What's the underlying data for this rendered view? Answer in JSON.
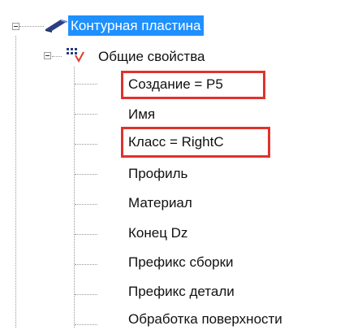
{
  "tree": {
    "root": {
      "label": "Контурная пластина",
      "icon": "plate-icon",
      "selected": true
    },
    "group": {
      "label": "Общие свойства",
      "icon": "properties-icon"
    },
    "properties": [
      {
        "label": "Создание = P5",
        "highlighted": true
      },
      {
        "label": "Имя",
        "highlighted": false
      },
      {
        "label": "Класс = RightC",
        "highlighted": true
      },
      {
        "label": "Профиль",
        "highlighted": false
      },
      {
        "label": "Материал",
        "highlighted": false
      },
      {
        "label": "Конец Dz",
        "highlighted": false
      },
      {
        "label": "Префикс сборки",
        "highlighted": false
      },
      {
        "label": "Префикс детали",
        "highlighted": false
      },
      {
        "label": "Обработка поверхности",
        "highlighted": false
      }
    ]
  },
  "colors": {
    "selection": "#1e90ff",
    "highlight_border": "#e0322c",
    "tree_lines": "#9a9a9a"
  }
}
